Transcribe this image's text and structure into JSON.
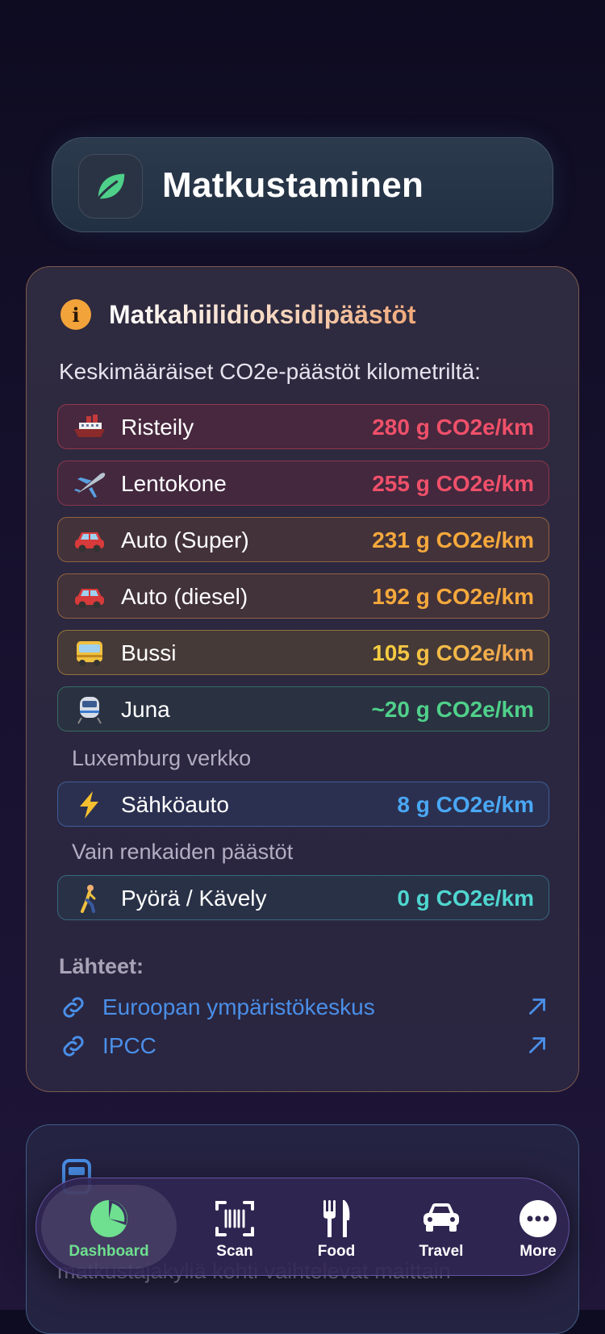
{
  "header": {
    "title": "Matkustaminen",
    "icon": "leaf-icon"
  },
  "card": {
    "title": "Matkahiilidioksidipäästöt",
    "subtitle": "Keskimääräiset CO2e-päästöt kilometriltä:",
    "items": [
      {
        "icon": "ship-emoji",
        "label": "Risteily",
        "value": "280 g CO2e/km",
        "color": "#f0506a"
      },
      {
        "icon": "airplane-emoji",
        "label": "Lentokone",
        "value": "255 g CO2e/km",
        "color": "#f0506a"
      },
      {
        "icon": "car-emoji",
        "label": "Auto (Super)",
        "value": "231 g CO2e/km",
        "color": "#f5a83c"
      },
      {
        "icon": "car-emoji",
        "label": "Auto (diesel)",
        "value": "192 g CO2e/km",
        "color": "#f5a83c"
      },
      {
        "icon": "bus-emoji",
        "label": "Bussi",
        "value": "105 g CO2e/km",
        "color": "#f5c540"
      },
      {
        "icon": "train-emoji",
        "label": "Juna",
        "value": "~20 g CO2e/km",
        "color": "#4fd08a",
        "note": "Luxemburg verkko"
      },
      {
        "icon": "lightning-emoji",
        "label": "Sähköauto",
        "value": "8 g CO2e/km",
        "color": "#4aa8f5",
        "note": "Vain renkaiden päästöt"
      },
      {
        "icon": "walking-emoji",
        "label": "Pyörä / Kävely",
        "value": "0 g CO2e/km",
        "color": "#4fd6d0"
      }
    ],
    "sources_label": "Lähteet:",
    "sources": [
      {
        "label": "Euroopan ympäristökeskus"
      },
      {
        "label": "IPCC"
      }
    ]
  },
  "card2": {
    "partial_text": "matkustajakyliä kohti vaihtelevat maittain"
  },
  "tabbar": {
    "tabs": [
      {
        "label": "Dashboard",
        "icon": "pie-chart-icon",
        "active": true
      },
      {
        "label": "Scan",
        "icon": "barcode-scan-icon"
      },
      {
        "label": "Food",
        "icon": "fork-knife-icon"
      },
      {
        "label": "Travel",
        "icon": "car-icon"
      },
      {
        "label": "More",
        "icon": "ellipsis-icon"
      }
    ]
  },
  "colors": {
    "accent_green": "#6ee08f",
    "info_orange": "#f2a33a",
    "link_blue": "#4a8fe8"
  }
}
